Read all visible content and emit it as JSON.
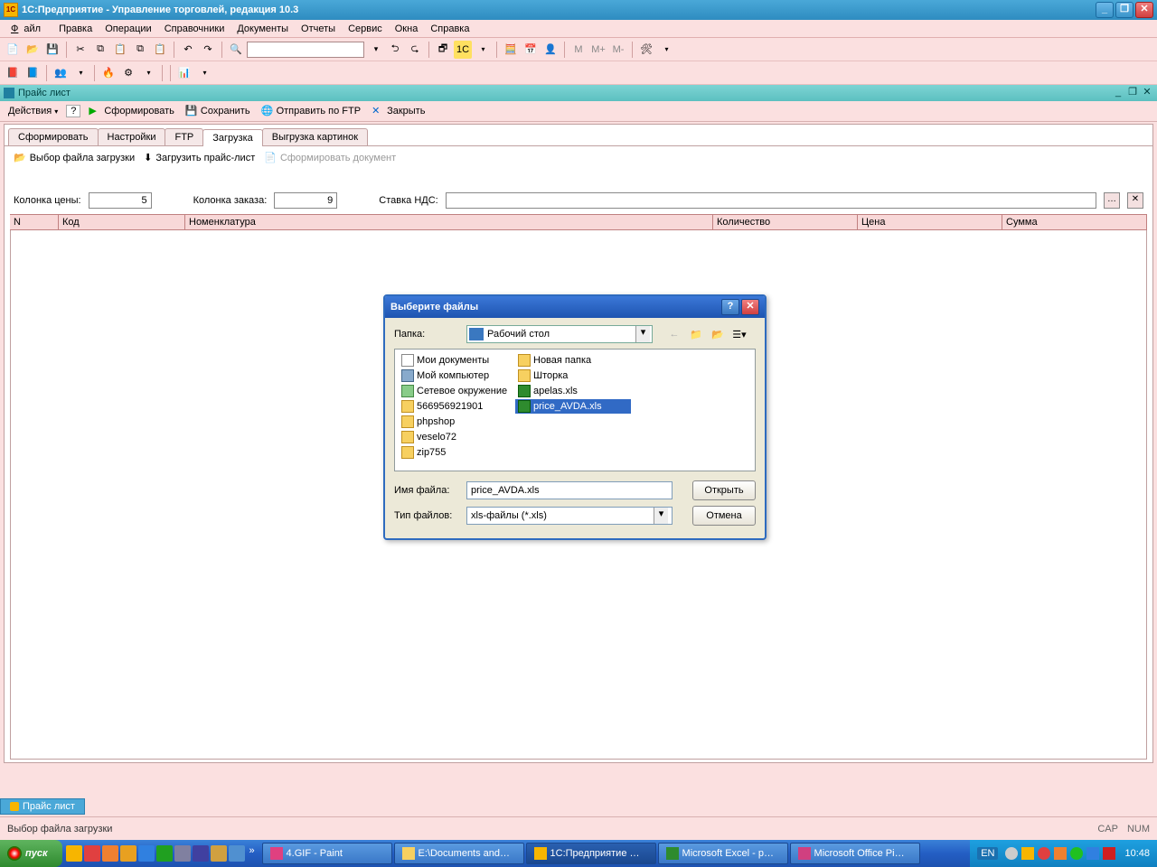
{
  "app": {
    "title": "1С:Предприятие - Управление торговлей, редакция 10.3"
  },
  "menu": {
    "file": "Файл",
    "edit": "Правка",
    "ops": "Операции",
    "refs": "Справочники",
    "docs": "Документы",
    "reports": "Отчеты",
    "service": "Сервис",
    "windows": "Окна",
    "help": "Справка"
  },
  "inner_window": {
    "title": "Прайс лист"
  },
  "action_bar": {
    "actions": "Действия",
    "form": "Сформировать",
    "save": "Сохранить",
    "ftp": "Отправить по FTP",
    "close": "Закрыть"
  },
  "tabs": {
    "t1": "Сформировать",
    "t2": "Настройки",
    "t3": "FTP",
    "t4": "Загрузка",
    "t5": "Выгрузка картинок"
  },
  "sub_actions": {
    "choose": "Выбор файла загрузки",
    "load": "Загрузить прайс-лист",
    "formdoc": "Сформировать документ"
  },
  "fields": {
    "price_col_label": "Колонка цены:",
    "price_col": "5",
    "order_col_label": "Колонка заказа:",
    "order_col": "9",
    "vat_label": "Ставка НДС:",
    "vat": ""
  },
  "grid": {
    "n": "N",
    "code": "Код",
    "nomen": "Номенклатура",
    "qty": "Количество",
    "price": "Цена",
    "sum": "Сумма"
  },
  "file_dialog": {
    "title": "Выберите файлы",
    "folder_label": "Папка:",
    "folder_value": "Рабочий стол",
    "files": [
      {
        "name": "Мои документы",
        "type": "doc"
      },
      {
        "name": "Мой компьютер",
        "type": "comp"
      },
      {
        "name": "Сетевое окружение",
        "type": "net"
      },
      {
        "name": "566956921901",
        "type": "folder"
      },
      {
        "name": "phpshop",
        "type": "folder"
      },
      {
        "name": "veselo72",
        "type": "folder"
      },
      {
        "name": "zip755",
        "type": "folder"
      },
      {
        "name": "Новая папка",
        "type": "folder"
      },
      {
        "name": "Шторка",
        "type": "folder"
      },
      {
        "name": "apelas.xls",
        "type": "xls"
      },
      {
        "name": "price_AVDA.xls",
        "type": "xls",
        "selected": true
      }
    ],
    "filename_label": "Имя файла:",
    "filename": "price_AVDA.xls",
    "filetype_label": "Тип файлов:",
    "filetype": "xls-файлы (*.xls)",
    "open": "Открыть",
    "cancel": "Отмена"
  },
  "bottom_tab": {
    "label": "Прайс лист"
  },
  "status": {
    "text": "Выбор файла загрузки",
    "cap": "CAP",
    "num": "NUM"
  },
  "taskbar": {
    "start": "пуск",
    "tasks": [
      {
        "label": "4.GIF - Paint",
        "color": "#e04080"
      },
      {
        "label": "E:\\Documents and…",
        "color": "#f7d060"
      },
      {
        "label": "1С:Предприятие …",
        "color": "#f7b500",
        "active": true
      },
      {
        "label": "Microsoft Excel - p…",
        "color": "#2e8b2e"
      },
      {
        "label": "Microsoft Office Pi…",
        "color": "#d04080"
      }
    ],
    "lang": "EN",
    "time": "10:48"
  }
}
